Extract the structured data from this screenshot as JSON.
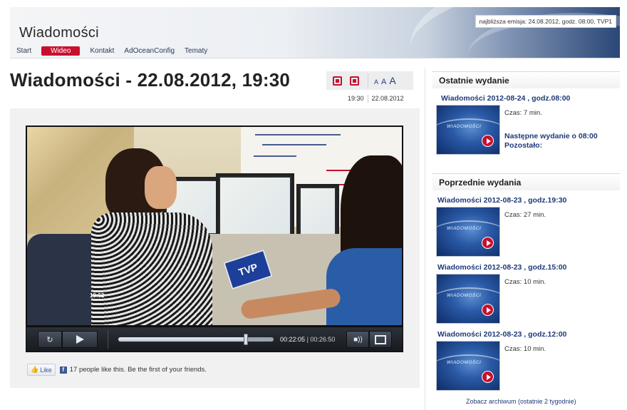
{
  "site": {
    "title": "Wiadomości"
  },
  "nav": {
    "items": [
      "Start",
      "Wideo",
      "Kontakt",
      "AdOceanConfig",
      "Tematy"
    ],
    "active": "Wideo"
  },
  "next_broadcast": "najbliższa emisja: 24.08.2012, godz. 08:00, TVP1",
  "article": {
    "title": "Wiadomości - 22.08.2012, 19:30",
    "time": "19:30",
    "date": "22.08.2012",
    "font_size_labels": [
      "A",
      "A",
      "A"
    ]
  },
  "player": {
    "current_time": "00:22:05",
    "total_time": "00:26:50",
    "progress_fraction": 0.823,
    "video_overlay": {
      "logo": "TVP",
      "clock": "19:52"
    }
  },
  "social": {
    "like_label": "Like",
    "like_text": "17 people like this. Be the first of your friends."
  },
  "sidebar": {
    "latest": {
      "header": "Ostatnie wydanie",
      "episode_title": "Wiadomości 2012-08-24 , godz.08:00",
      "duration": "Czas: 7 min.",
      "next_line1": "Następne wydanie o 08:00",
      "next_line2": "Pozostało:"
    },
    "previous": {
      "header": "Poprzednie wydania",
      "episodes": [
        {
          "title": "Wiadomości 2012-08-23 , godz.19:30",
          "duration": "Czas: 27 min."
        },
        {
          "title": "Wiadomości 2012-08-23 , godz.15:00",
          "duration": "Czas: 10 min."
        },
        {
          "title": "Wiadomości 2012-08-23 , godz.12:00",
          "duration": "Czas: 10 min."
        }
      ]
    },
    "archive_link": "Zobacz archiwum (ostatnie 2 tygodnie)",
    "thumb_brand": "WIADOMOŚCI"
  }
}
